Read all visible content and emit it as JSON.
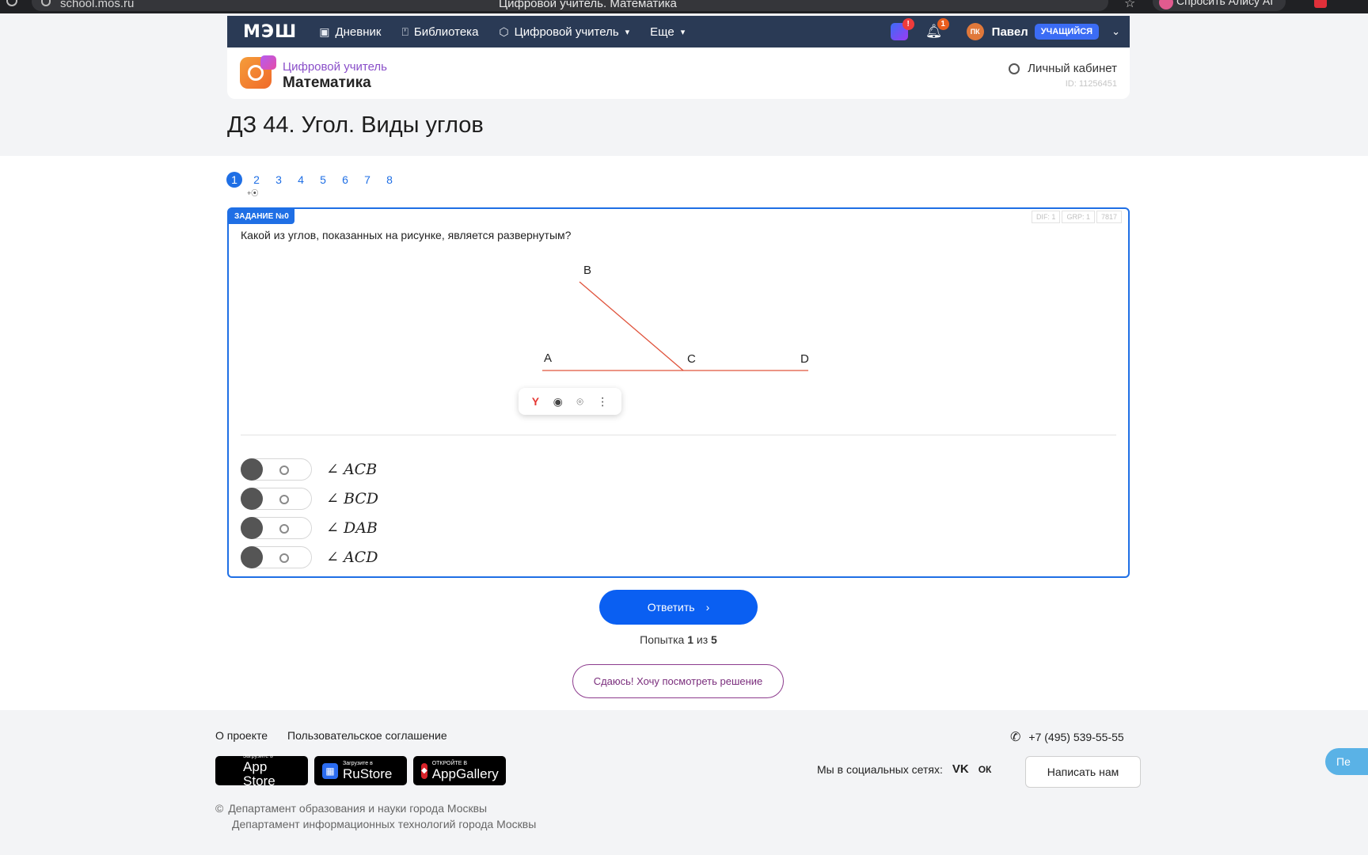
{
  "browser": {
    "url": "school.mos.ru",
    "tab_title": "Цифровой учитель. Математика",
    "alice_label": "Спросить Алису AI"
  },
  "topnav": {
    "logo": "МЭШ",
    "items": [
      {
        "label": "Дневник",
        "icon": "diary-icon"
      },
      {
        "label": "Библиотека",
        "icon": "bookmark-icon"
      },
      {
        "label": "Цифровой учитель",
        "icon": "cube-icon"
      },
      {
        "label": "Еще",
        "icon": ""
      }
    ],
    "app_badge": "!",
    "notifications_badge": "1",
    "avatar_initials": "ПК",
    "user_name": "Павел",
    "role": "УЧАЩИЙСЯ"
  },
  "subject": {
    "title": "Цифровой учитель",
    "name": "Математика",
    "cabinet_label": "Личный кабинет",
    "user_id": "ID: 11256451"
  },
  "page_title": "ДЗ 44. Угол. Виды углов",
  "task_nav": {
    "numbers": [
      "1",
      "2",
      "3",
      "4",
      "5",
      "6",
      "7",
      "8"
    ],
    "active": "1",
    "sub_label": "+⦿"
  },
  "task": {
    "tag": "ЗАДАНИЕ №0",
    "meta": [
      "DIF: 1",
      "GRP: 1",
      "7817"
    ],
    "question": "Какой из углов, показанных на рисунке, является развернутым?",
    "figure_labels": {
      "a": "A",
      "b": "B",
      "c": "C",
      "d": "D"
    },
    "line_color": "#e0533c",
    "options": [
      "∠ ACB",
      "∠ BCD",
      "∠ DAB",
      "∠ ACD"
    ]
  },
  "actions": {
    "answer_label": "Ответить",
    "attempt_prefix": "Попытка",
    "attempt_current": "1",
    "attempt_of": "из",
    "attempt_total": "5",
    "giveup_label": "Сдаюсь! Хочу посмотреть решение"
  },
  "footer": {
    "about": "О проекте",
    "agreement": "Пользовательское соглашение",
    "phone": "+7 (495) 539-55-55",
    "stores": [
      {
        "small": "Загрузите в",
        "big": "App Store"
      },
      {
        "small": "Загрузите в",
        "big": "RuStore"
      },
      {
        "small": "ОТКРОЙТЕ В",
        "big": "AppGallery"
      }
    ],
    "social_label": "Мы в социальных сетях:",
    "social_vk": "VK",
    "social_ok": "ОК",
    "write_label": "Написать нам",
    "copyright_line1": "Департамент образования и науки города Москвы",
    "copyright_line2": "Департамент информационных технологий города Москвы",
    "float_label": "Пе"
  },
  "colors": {
    "nav_bg": "#2a3a55",
    "accent": "#1f6fe5",
    "button": "#0a5ff2",
    "giveup_border": "#8d3c8e"
  }
}
